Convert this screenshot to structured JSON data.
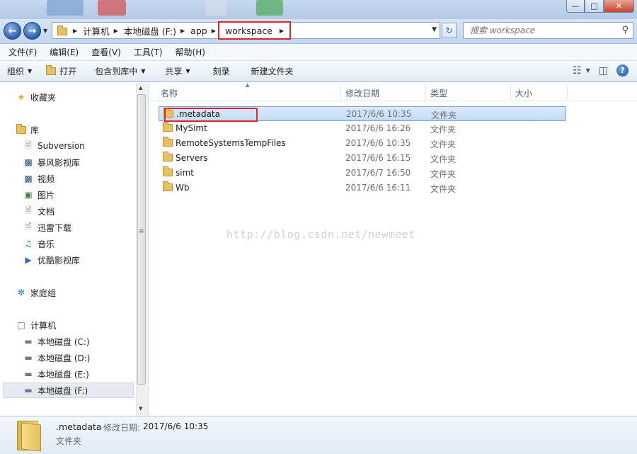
{
  "window": {
    "min_icon": "minimize-icon",
    "max_icon": "maximize-icon",
    "close_icon": "close-icon"
  },
  "address": {
    "crumbs": [
      "计算机",
      "本地磁盘 (F:)",
      "app",
      "workspace"
    ]
  },
  "search": {
    "placeholder": "搜索 workspace"
  },
  "menu": [
    "文件(F)",
    "编辑(E)",
    "查看(V)",
    "工具(T)",
    "帮助(H)"
  ],
  "toolbar": {
    "organize": "组织",
    "open": "打开",
    "include_in_library": "包含到库中",
    "share": "共享",
    "burn": "刻录",
    "new_folder": "新建文件夹"
  },
  "nav": {
    "favorites": "收藏夹",
    "libraries": "库",
    "library_items": [
      "Subversion",
      "暴风影视库",
      "视频",
      "图片",
      "文档",
      "迅雷下载",
      "音乐",
      "优酷影视库"
    ],
    "homegroup": "家庭组",
    "computer": "计算机",
    "drives": [
      "本地磁盘 (C:)",
      "本地磁盘 (D:)",
      "本地磁盘 (E:)",
      "本地磁盘 (F:)"
    ]
  },
  "columns": {
    "name": "名称",
    "modified": "修改日期",
    "type": "类型",
    "size": "大小"
  },
  "files": [
    {
      "name": ".metadata",
      "modified": "2017/6/6 10:35",
      "type": "文件夹"
    },
    {
      "name": "MySimt",
      "modified": "2017/6/6 16:26",
      "type": "文件夹"
    },
    {
      "name": "RemoteSystemsTempFiles",
      "modified": "2017/6/6 10:35",
      "type": "文件夹"
    },
    {
      "name": "Servers",
      "modified": "2017/6/6 16:15",
      "type": "文件夹"
    },
    {
      "name": "simt",
      "modified": "2017/6/7 16:50",
      "type": "文件夹"
    },
    {
      "name": "Wb",
      "modified": "2017/6/6 16:11",
      "type": "文件夹"
    }
  ],
  "watermark": "http://blog.csdn.net/newmeet",
  "details": {
    "name": ".metadata",
    "modified_label": "修改日期:",
    "modified_value": "2017/6/6 10:35",
    "type": "文件夹"
  },
  "colors": {
    "highlight": "#e0252c",
    "selection": "#c2dcf8"
  }
}
